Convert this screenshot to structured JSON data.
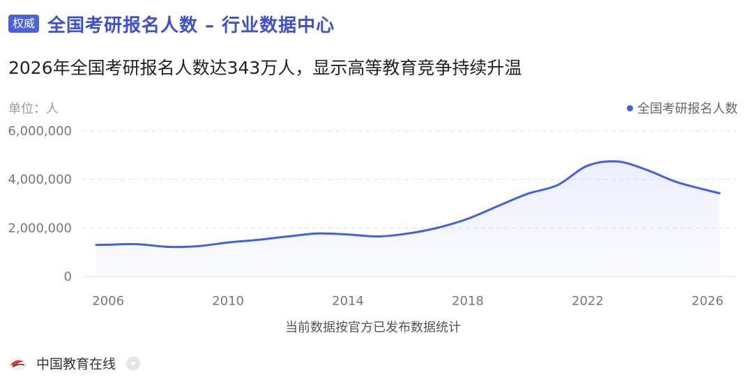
{
  "header": {
    "badge": "权威",
    "title": "全国考研报名人数 – 行业数据中心"
  },
  "subtitle": "2026年全国考研报名人数达343万人，显示高等教育竞争持续升温",
  "colors": {
    "accent": "#3f5ff0",
    "title": "#3b50d6",
    "badge_bg": "#4a62e0"
  },
  "chart_data": {
    "type": "area",
    "unit_label": "单位：人",
    "note": "当前数据按官方已发布数据统计",
    "series": [
      {
        "name": "全国考研报名人数",
        "x": [
          2005.6,
          2006,
          2007,
          2008,
          2009,
          2010,
          2011,
          2012,
          2013,
          2014,
          2015,
          2016,
          2017,
          2018,
          2019,
          2020,
          2021,
          2022,
          2023,
          2024,
          2025,
          2026.4
        ],
        "values": [
          1300000,
          1310000,
          1330000,
          1220000,
          1250000,
          1400000,
          1510000,
          1650000,
          1770000,
          1730000,
          1650000,
          1770000,
          2010000,
          2380000,
          2900000,
          3410000,
          3770000,
          4570000,
          4740000,
          4380000,
          3880000,
          3430000
        ]
      }
    ],
    "xlim": [
      2005.6,
      2026.4
    ],
    "ylim": [
      0,
      6000000
    ],
    "xticks": [
      2006,
      2010,
      2014,
      2018,
      2022,
      2026
    ],
    "xtick_labels": [
      "2006",
      "2010",
      "2014",
      "2018",
      "2022",
      "2026"
    ],
    "yticks": [
      0,
      2000000,
      4000000,
      6000000
    ],
    "ytick_labels": [
      "0",
      "2,000,000",
      "4,000,000",
      "6,000,000"
    ],
    "grid": true,
    "legend_position": "top-right"
  },
  "footer": {
    "source_name": "中国教育在线",
    "logo_icon": "cernet-logo-icon",
    "chevron_icon": "chevron-down-icon"
  }
}
